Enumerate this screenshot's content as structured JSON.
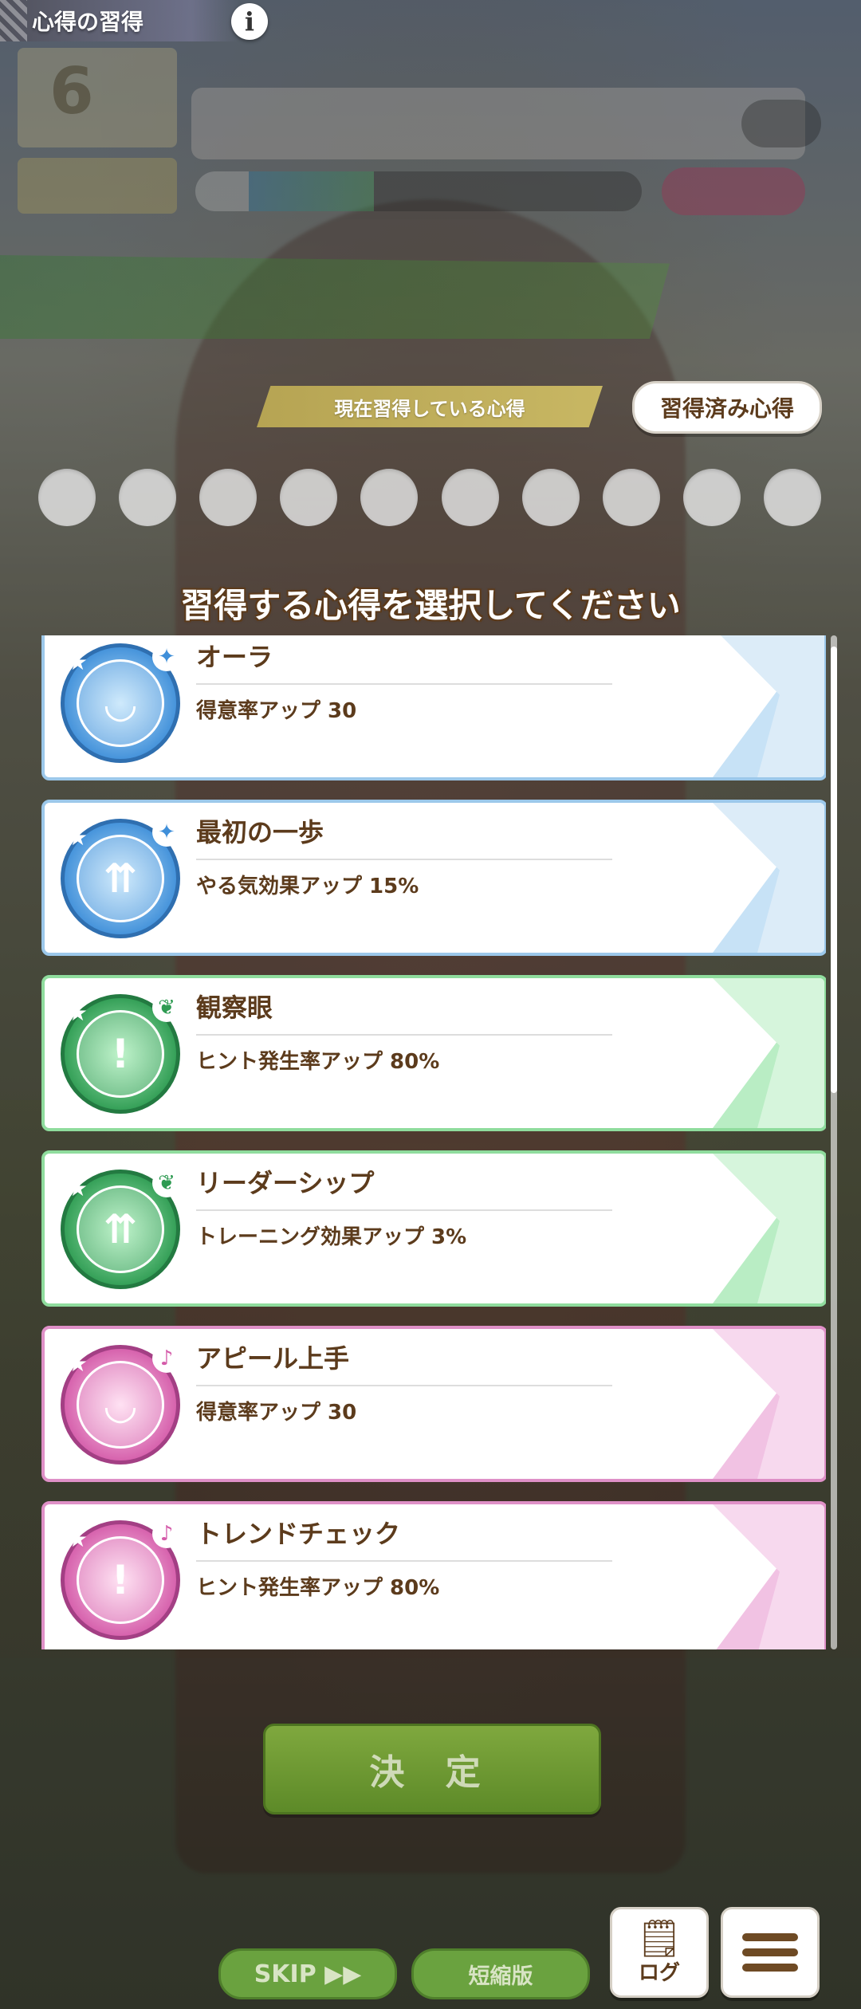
{
  "header": {
    "title": "心得の習得",
    "info_icon": "i"
  },
  "current": {
    "label": "現在習得している心得",
    "acquired_button": "習得済み心得",
    "empty_slot_count": 10
  },
  "prompt": "習得する心得を選択してください",
  "mindsets": [
    {
      "name": "オーラ",
      "description": "得意率アップ 30",
      "color": "blue",
      "icon": "rabbit-mood-icon",
      "glyph": "◡"
    },
    {
      "name": "最初の一歩",
      "description": "やる気効果アップ 15%",
      "color": "blue",
      "icon": "dumbbell-up-icon",
      "glyph": "⇈"
    },
    {
      "name": "観察眼",
      "description": "ヒント発生率アップ 80%",
      "color": "green",
      "icon": "exclamation-hint-icon",
      "glyph": "!"
    },
    {
      "name": "リーダーシップ",
      "description": "トレーニング効果アップ 3%",
      "color": "green",
      "icon": "dumbbell-up-icon",
      "glyph": "⇈"
    },
    {
      "name": "アピール上手",
      "description": "得意率アップ 30",
      "color": "pink",
      "icon": "rabbit-mood-icon",
      "glyph": "◡"
    },
    {
      "name": "トレンドチェック",
      "description": "ヒント発生率アップ 80%",
      "color": "pink",
      "icon": "exclamation-hint-icon",
      "glyph": "!"
    }
  ],
  "footer": {
    "confirm": "決 定",
    "skip": "SKIP ▶▶",
    "short": "短縮版",
    "log": "ログ"
  },
  "colors": {
    "brown_text": "#5c3b1c",
    "blue": "#3f8fd9",
    "green": "#2e9b52",
    "pink": "#d45ba9",
    "confirm_green": "#6aa23f"
  }
}
